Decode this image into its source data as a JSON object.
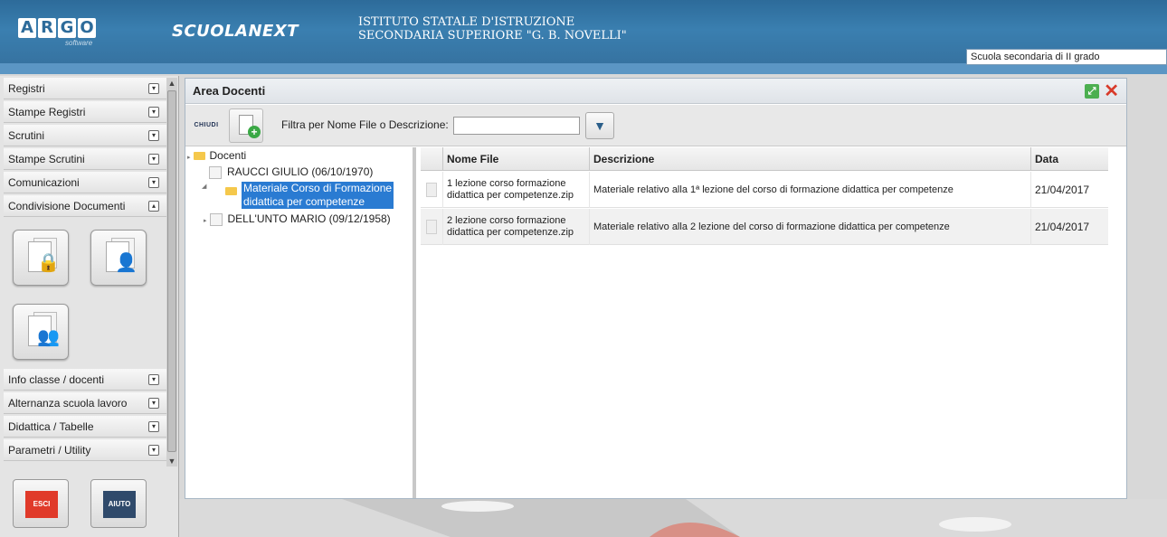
{
  "header": {
    "logo_letters": [
      "A",
      "R",
      "G",
      "O"
    ],
    "logo_sub": "software",
    "app_name": "SCUOLANEXT",
    "school_line1": "ISTITUTO STATALE D'ISTRUZIONE",
    "school_line2": "SECONDARIA SUPERIORE \"G. B. NOVELLI\"",
    "school_type": "Scuola secondaria di II grado"
  },
  "sidebar": {
    "items": [
      {
        "label": "Registri"
      },
      {
        "label": "Stampe Registri"
      },
      {
        "label": "Scrutini"
      },
      {
        "label": "Stampe Scrutini"
      },
      {
        "label": "Comunicazioni"
      },
      {
        "label": "Condivisione Documenti"
      },
      {
        "label": "Info classe / docenti"
      },
      {
        "label": "Alternanza scuola lavoro"
      },
      {
        "label": "Didattica / Tabelle"
      },
      {
        "label": "Parametri / Utility"
      }
    ],
    "tiles": [
      {
        "icon": "lock-document-icon"
      },
      {
        "icon": "user-document-icon"
      },
      {
        "icon": "group-document-icon"
      }
    ],
    "exit_label": "ESCI",
    "help_label": "AIUTO"
  },
  "panel": {
    "title": "Area Docenti",
    "close_label": "CHIUDI",
    "filter_label": "Filtra per Nome File o Descrizione:",
    "filter_value": ""
  },
  "tree": {
    "root": "Docenti",
    "teachers": [
      {
        "name": "RAUCCI GIULIO (06/10/1970)",
        "folder_line1": "Materiale Corso di Formazione",
        "folder_line2": "didattica per competenze"
      },
      {
        "name": "DELL'UNTO MARIO (09/12/1958)"
      }
    ]
  },
  "grid": {
    "columns": [
      "Nome File",
      "Descrizione",
      "Data"
    ],
    "rows": [
      {
        "file_line1": "1 lezione corso formazione",
        "file_line2": "didattica per competenze.zip",
        "descrizione": "Materiale relativo alla 1ª lezione del corso di formazione didattica per competenze",
        "data": "21/04/2017"
      },
      {
        "file_line1": "2 lezione corso formazione",
        "file_line2": "didattica per competenze.zip",
        "descrizione": "Materiale relativo alla 2 lezione del corso di formazione didattica per competenze",
        "data": "21/04/2017"
      }
    ]
  },
  "colors": {
    "header_blue": "#3a7fb0",
    "selection_blue": "#2a7bd2",
    "close_red": "#d83a2a",
    "exit_red": "#e03a2a",
    "help_navy": "#2f4a6b"
  }
}
